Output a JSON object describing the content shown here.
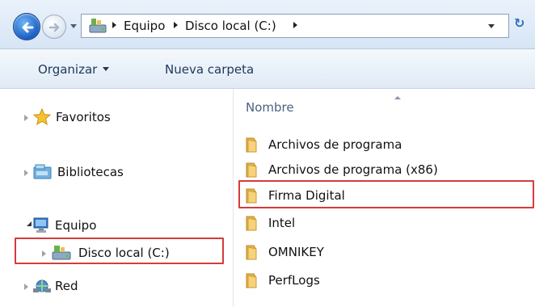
{
  "address": {
    "crumbs": [
      "Equipo",
      "Disco local (C:)"
    ]
  },
  "toolbar": {
    "organize_label": "Organizar",
    "new_folder_label": "Nueva carpeta"
  },
  "nav": {
    "favorites": "Favoritos",
    "libraries": "Bibliotecas",
    "computer": "Equipo",
    "local_disk": "Disco local (C:)",
    "network": "Red"
  },
  "content": {
    "column_name": "Nombre",
    "files": [
      "Archivos de programa",
      "Archivos de programa (x86)",
      "Firma Digital",
      "Intel",
      "OMNIKEY",
      "PerfLogs"
    ]
  },
  "colors": {
    "highlight": "#d63b3b",
    "folder": "#e9b84a",
    "toolbar_text": "#1e395b"
  }
}
